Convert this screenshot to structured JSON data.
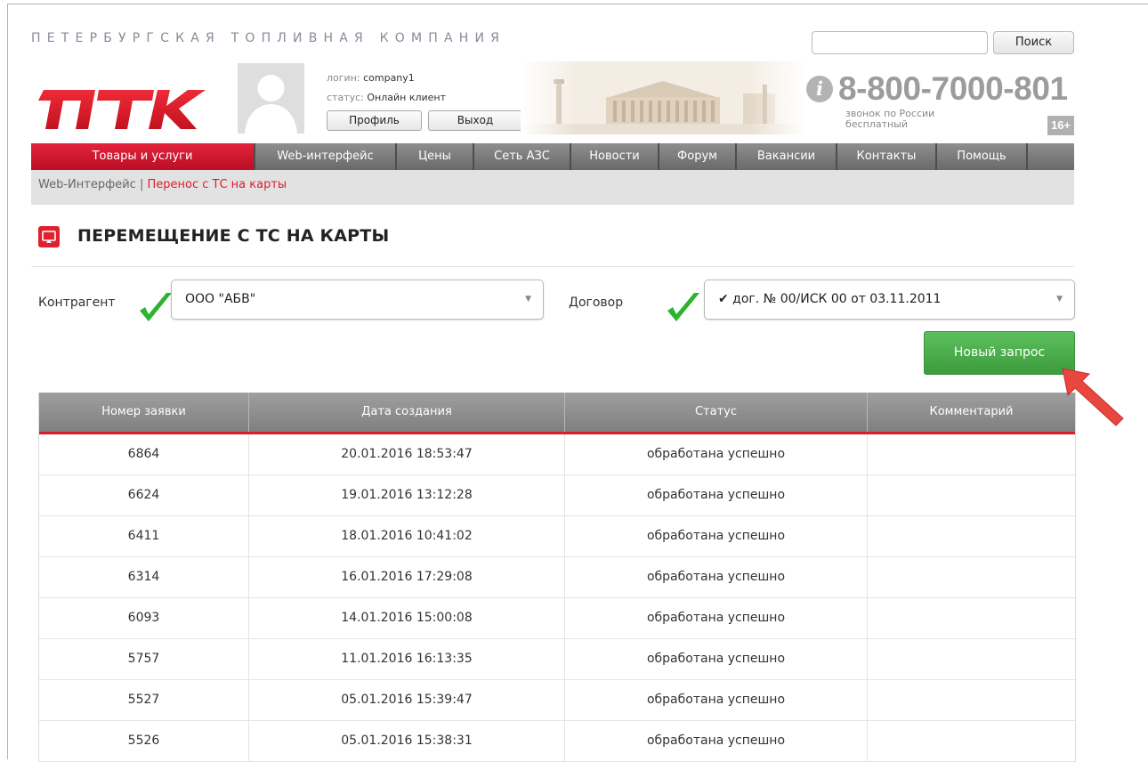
{
  "header": {
    "tagline": "ПЕТЕРБУРГСКАЯ ТОПЛИВНАЯ КОМПАНИЯ",
    "search_placeholder": "",
    "search_button": "Поиск",
    "logo_text": "ПТК",
    "user": {
      "login_label": "логин:",
      "login_value": "company1",
      "status_label": "статус:",
      "status_value": "Онлайн клиент",
      "profile_button": "Профиль",
      "logout_button": "Выход"
    },
    "phone": "8-800-7000-801",
    "phone_note_line1": "звонок по России",
    "phone_note_line2": "бесплатный",
    "age_badge": "16+"
  },
  "nav": {
    "items": [
      {
        "label": "Товары и услуги",
        "active": true
      },
      {
        "label": "Web-интерфейс",
        "active": false
      },
      {
        "label": "Цены",
        "active": false
      },
      {
        "label": "Сеть АЗС",
        "active": false
      },
      {
        "label": "Новости",
        "active": false
      },
      {
        "label": "Форум",
        "active": false
      },
      {
        "label": "Вакансии",
        "active": false
      },
      {
        "label": "Контакты",
        "active": false
      },
      {
        "label": "Помощь",
        "active": false
      }
    ]
  },
  "breadcrumb": {
    "parent": "Web-Интерфейс",
    "separator": "|",
    "current": "Перенос с ТС на карты"
  },
  "page": {
    "title": "ПЕРЕМЕЩЕНИЕ С ТС НА КАРТЫ"
  },
  "form": {
    "counterparty_label": "Контрагент",
    "counterparty_value": "ООО \"АБВ\"",
    "contract_label": "Договор",
    "contract_value": "✔ дог. № 00/ИСК 00 от 03.11.2011",
    "new_request_button": "Новый запрос"
  },
  "table": {
    "columns": [
      "Номер заявки",
      "Дата создания",
      "Статус",
      "Комментарий"
    ],
    "rows": [
      {
        "number": "6864",
        "date": "20.01.2016 18:53:47",
        "status": "обработана успешно",
        "comment": ""
      },
      {
        "number": "6624",
        "date": "19.01.2016 13:12:28",
        "status": "обработана успешно",
        "comment": ""
      },
      {
        "number": "6411",
        "date": "18.01.2016 10:41:02",
        "status": "обработана успешно",
        "comment": ""
      },
      {
        "number": "6314",
        "date": "16.01.2016 17:29:08",
        "status": "обработана успешно",
        "comment": ""
      },
      {
        "number": "6093",
        "date": "14.01.2016 15:00:08",
        "status": "обработана успешно",
        "comment": ""
      },
      {
        "number": "5757",
        "date": "11.01.2016 16:13:35",
        "status": "обработана успешно",
        "comment": ""
      },
      {
        "number": "5527",
        "date": "05.01.2016 15:39:47",
        "status": "обработана успешно",
        "comment": ""
      },
      {
        "number": "5526",
        "date": "05.01.2016 15:38:31",
        "status": "обработана успешно",
        "comment": ""
      }
    ]
  },
  "colors": {
    "brand_red": "#e0202e",
    "nav_gray": "#7a7a7a",
    "button_green": "#4cae4c",
    "arrow_red": "#e8473f"
  },
  "icons": {
    "info": "info-icon",
    "check": "check-icon",
    "dropdown": "chevron-down-icon",
    "title": "monitor-icon"
  }
}
